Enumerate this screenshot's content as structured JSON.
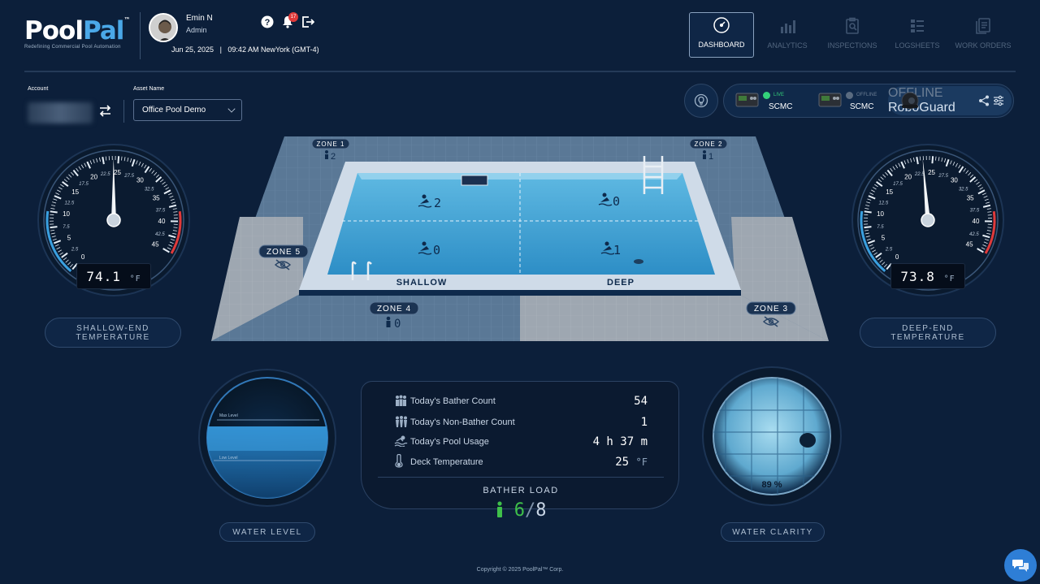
{
  "brand": {
    "logo_main": "Pool",
    "logo_accent": "Pal",
    "logo_tm": "™",
    "tagline": "Redefining Commercial Pool Automation"
  },
  "user": {
    "name": "Emin N",
    "role": "Admin",
    "notifications": "17"
  },
  "datetime": {
    "date": "Jun 25, 2025",
    "separator": "|",
    "time": "09:42 AM NewYork (GMT-4)"
  },
  "nav": [
    {
      "label": "DASHBOARD",
      "icon": "speedometer-icon",
      "active": true
    },
    {
      "label": "ANALYTICS",
      "icon": "bar-chart-icon",
      "active": false
    },
    {
      "label": "INSPECTIONS",
      "icon": "clipboard-search-icon",
      "active": false
    },
    {
      "label": "LOGSHEETS",
      "icon": "list-icon",
      "active": false
    },
    {
      "label": "WORK ORDERS",
      "icon": "document-stack-icon",
      "active": false
    }
  ],
  "account": {
    "label": "Account",
    "asset_label": "Asset Name",
    "asset_value": "Office Pool Demo"
  },
  "devices": [
    {
      "name": "SCMC",
      "status": "LIVE",
      "color": "#33d17a"
    },
    {
      "name": "SCMC",
      "status": "OFFLINE",
      "color": "#5a6b80"
    },
    {
      "name": "RoboGuard",
      "status": "OFFLINE",
      "color": "#5a6b80"
    }
  ],
  "shallow_gauge": {
    "reading": "74.1",
    "unit": "°F",
    "label_line1": "SHALLOW-END",
    "label_line2": "TEMPERATURE",
    "scale": [
      "0",
      "2.5",
      "5",
      "7.5",
      "10",
      "12.5",
      "15",
      "17.5",
      "20",
      "22.5",
      "25",
      "27.5",
      "30",
      "32.5",
      "35",
      "37.5",
      "40",
      "42.5",
      "45"
    ],
    "needle_value": 24.2
  },
  "deep_gauge": {
    "reading": "73.8",
    "unit": "°F",
    "label_line1": "DEEP-END",
    "label_line2": "TEMPERATURE",
    "scale": [
      "0",
      "2.5",
      "5",
      "7.5",
      "10",
      "12.5",
      "15",
      "17.5",
      "20",
      "22.5",
      "25",
      "27.5",
      "30",
      "32.5",
      "35",
      "37.5",
      "40",
      "42.5",
      "45"
    ],
    "needle_value": 23.4
  },
  "pool": {
    "shallow_label": "SHALLOW",
    "deep_label": "DEEP",
    "zones": [
      {
        "label": "ZONE 1",
        "count": "2",
        "hidden": false
      },
      {
        "label": "ZONE 2",
        "count": "1",
        "hidden": false
      },
      {
        "label": "ZONE 3",
        "count": "",
        "hidden": true
      },
      {
        "label": "ZONE 4",
        "count": "0",
        "hidden": false
      },
      {
        "label": "ZONE 5",
        "count": "",
        "hidden": true
      }
    ],
    "quadrants": {
      "shallow_top": "2",
      "deep_top": "0",
      "shallow_bottom": "0",
      "deep_bottom": "1"
    }
  },
  "water_level": {
    "label": "WATER LEVEL",
    "max_label": "Max Level",
    "low_label": "Low Level"
  },
  "water_clarity": {
    "label": "WATER CLARITY",
    "value": "89 %"
  },
  "stats": [
    {
      "label": "Today's Bather Count",
      "value": "54",
      "unit": ""
    },
    {
      "label": "Today's Non-Bather Count",
      "value": "1",
      "unit": ""
    },
    {
      "label": "Today's Pool Usage",
      "value": "4 h 37 m",
      "unit": ""
    },
    {
      "label": "Deck Temperature",
      "value": "25",
      "unit": "°F"
    }
  ],
  "bather_load": {
    "title": "BATHER LOAD",
    "current": "6",
    "separator": "/",
    "max": "8"
  },
  "footer": {
    "copyright": "Copyright © 2025 PoolPal™ Corp."
  },
  "colors": {
    "accent": "#4aa8e8",
    "live": "#33d17a",
    "alert": "#e03a3a",
    "load": "#3fc04a"
  }
}
